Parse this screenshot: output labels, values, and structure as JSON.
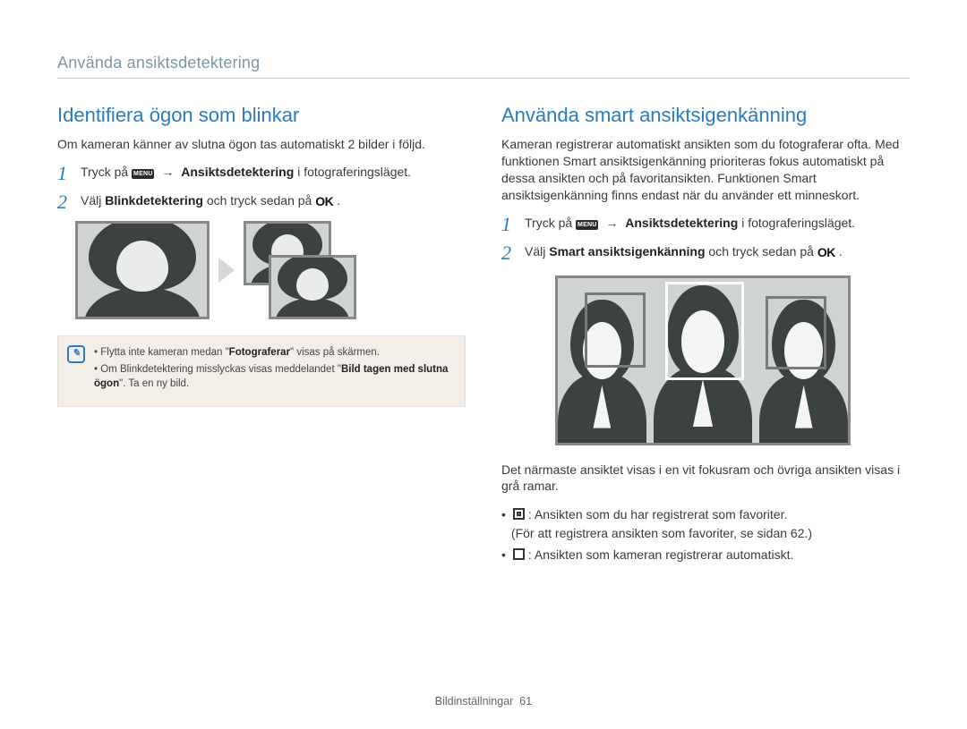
{
  "breadcrumb": "Använda ansiktsdetektering",
  "left": {
    "title": "Identifiera ögon som blinkar",
    "intro": "Om kameran känner av slutna ögon tas automatiskt 2 bilder i följd.",
    "step1_pre": "Tryck på ",
    "step1_menu": "MENU",
    "step1_arrow": "→",
    "step1_bold": "Ansiktsdetektering",
    "step1_post": " i fotograferingsläget.",
    "step2_pre": "Välj ",
    "step2_bold": "Blinkdetektering",
    "step2_mid": " och tryck sedan på ",
    "step2_ok": "OK",
    "step2_post": ".",
    "note1_a": "Flytta inte kameran medan \"",
    "note1_b": "Fotograferar",
    "note1_c": "\" visas på skärmen.",
    "note2_a": "Om Blinkdetektering misslyckas visas meddelandet \"",
    "note2_b": "Bild tagen med slutna ögon",
    "note2_c": "\". Ta en ny bild."
  },
  "right": {
    "title": "Använda smart ansiktsigenkänning",
    "intro": "Kameran registrerar automatiskt ansikten som du fotograferar ofta. Med funktionen Smart ansiktsigenkänning prioriteras fokus automatiskt på dessa ansikten och på favoritansikten. Funktionen Smart ansiktsigenkänning finns endast när du använder ett minneskort.",
    "step1_pre": "Tryck på ",
    "step1_menu": "MENU",
    "step1_arrow": "→",
    "step1_bold": "Ansiktsdetektering",
    "step1_post": " i fotograferingsläget.",
    "step2_pre": "Välj ",
    "step2_bold": "Smart ansiktsigenkänning",
    "step2_mid": " och tryck sedan på ",
    "step2_ok": "OK",
    "step2_post": ".",
    "after_img": "Det närmaste ansiktet visas i en vit fokusram och övriga ansikten visas i grå ramar.",
    "b1": ": Ansikten som du har registrerat som favoriter.",
    "b1_sub": "(För att registrera ansikten som favoriter, se sidan 62.)",
    "b2": ": Ansikten som kameran registrerar automatiskt."
  },
  "footer_label": "Bildinställningar",
  "footer_page": "61"
}
